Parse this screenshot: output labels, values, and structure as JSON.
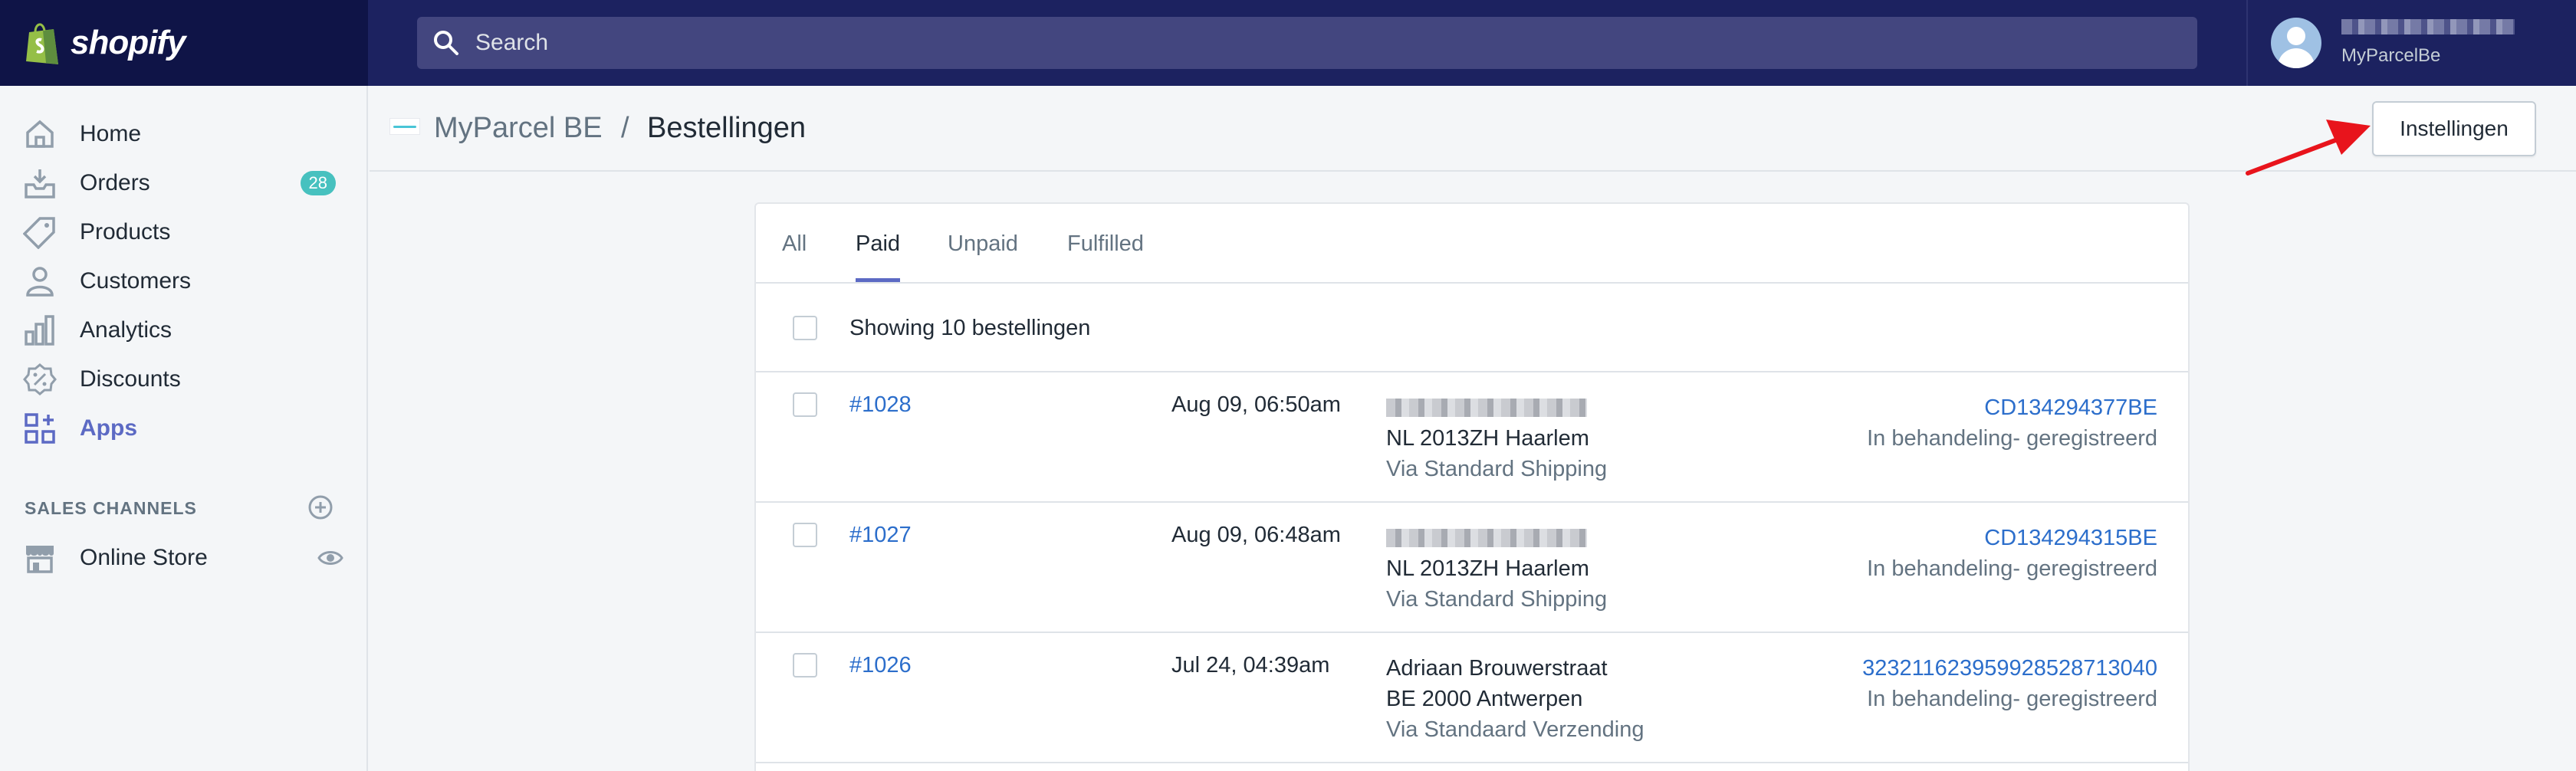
{
  "topbar": {
    "logo_text": "shopify",
    "search_placeholder": "Search",
    "user": {
      "store": "MyParcelBe"
    }
  },
  "sidebar": {
    "items": [
      {
        "label": "Home",
        "icon": "home-icon"
      },
      {
        "label": "Orders",
        "icon": "orders-icon",
        "badge": "28"
      },
      {
        "label": "Products",
        "icon": "tag-icon"
      },
      {
        "label": "Customers",
        "icon": "person-icon"
      },
      {
        "label": "Analytics",
        "icon": "bar-chart-icon"
      },
      {
        "label": "Discounts",
        "icon": "discount-icon"
      },
      {
        "label": "Apps",
        "icon": "apps-icon",
        "active": true
      }
    ],
    "sales_channels_title": "SALES CHANNELS",
    "channels": [
      {
        "label": "Online Store",
        "icon": "store-icon"
      }
    ]
  },
  "header": {
    "app_name": "MyParcel BE",
    "separator": "/",
    "page_title": "Bestellingen",
    "settings_button": "Instellingen"
  },
  "orders_card": {
    "tabs": [
      "All",
      "Paid",
      "Unpaid",
      "Fulfilled"
    ],
    "active_tab": "Paid",
    "showing_text": "Showing 10 bestellingen",
    "rows": [
      {
        "id": "#1028",
        "date": "Aug 09, 06:50am",
        "address_line2": "NL 2013ZH Haarlem",
        "shipping": "Via Standard Shipping",
        "tracking": "CD134294377BE",
        "status": "In behandeling- geregistreerd"
      },
      {
        "id": "#1027",
        "date": "Aug 09, 06:48am",
        "address_line2": "NL 2013ZH Haarlem",
        "shipping": "Via Standard Shipping",
        "tracking": "CD134294315BE",
        "status": "In behandeling- geregistreerd"
      },
      {
        "id": "#1026",
        "date": "Jul 24, 04:39am",
        "address_line1": "Adriaan Brouwerstraat",
        "address_line2": "BE 2000 Antwerpen",
        "shipping": "Via Standaard Verzending",
        "tracking": "323211623959928528713040",
        "status": "In behandeling- geregistreerd"
      }
    ]
  },
  "colors": {
    "topbar": "#1c2260",
    "logo_bg": "#0f1447",
    "accent": "#5c6ac4",
    "link": "#2c6ecb",
    "badge": "#47c1bf",
    "arrow": "#e8141c"
  }
}
